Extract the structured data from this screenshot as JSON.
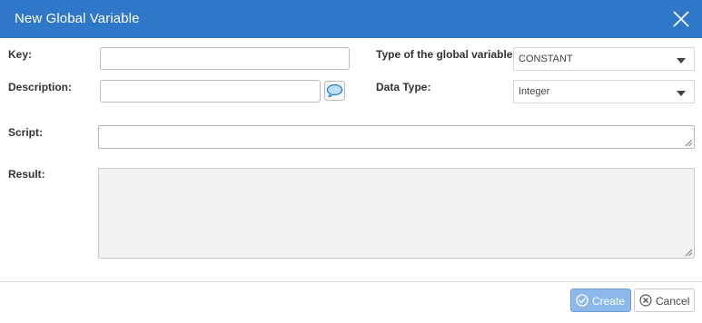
{
  "dialog": {
    "title": "New Global Variable",
    "colors": {
      "header": "#2f78c9",
      "primary_button": "#8db8ea"
    }
  },
  "form": {
    "key_label": "Key:",
    "key_value": "",
    "description_label": "Description:",
    "description_value": "",
    "type_label": "Type of the global variable:",
    "type_selected": "CONSTANT",
    "data_type_label": "Data Type:",
    "data_type_selected": "Integer",
    "script_label": "Script:",
    "script_value": "",
    "result_label": "Result:",
    "result_value": ""
  },
  "icons": {
    "close": "close-icon",
    "comment": "speech-bubble-icon",
    "create": "check-circle-icon",
    "cancel": "x-circle-icon"
  },
  "buttons": {
    "create_label": "Create",
    "cancel_label": "Cancel"
  }
}
